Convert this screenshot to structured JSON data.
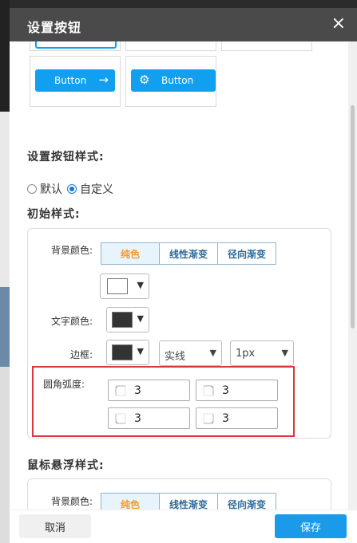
{
  "dialog": {
    "title": "设置按钮",
    "close_glyph": "×"
  },
  "preview": {
    "button1": {
      "label": "Button",
      "icon": "arrow-right-icon",
      "glyph": "→"
    },
    "button2": {
      "label": "Button",
      "icon": "gear-icon",
      "glyph": "⚙"
    }
  },
  "style_section": {
    "title": "设置按钮样式:",
    "options": [
      "默认",
      "自定义"
    ],
    "selected": "自定义"
  },
  "initial": {
    "title": "初始样式:",
    "bg_label": "背景颜色:",
    "tabs": [
      "纯色",
      "线性渐变",
      "径向渐变"
    ],
    "active_tab": "纯色",
    "bg_color": "#ffffff",
    "text_color_label": "文字颜色:",
    "text_color": "#333333",
    "border_label": "边框:",
    "border_color": "#333333",
    "border_style": "实线",
    "border_width": "1px",
    "radius_label": "圆角弧度:",
    "radius": [
      "3",
      "3",
      "3",
      "3"
    ]
  },
  "hover": {
    "title": "鼠标悬浮样式:",
    "bg_label": "背景颜色:",
    "tabs": [
      "纯色",
      "线性渐变",
      "径向渐变"
    ],
    "active_tab": "纯色"
  },
  "footer": {
    "cancel": "取消",
    "save": "保存"
  },
  "colors": {
    "accent": "#1a9ae8",
    "tab_active_text": "#f39a2f",
    "highlight": "#d9363e"
  }
}
